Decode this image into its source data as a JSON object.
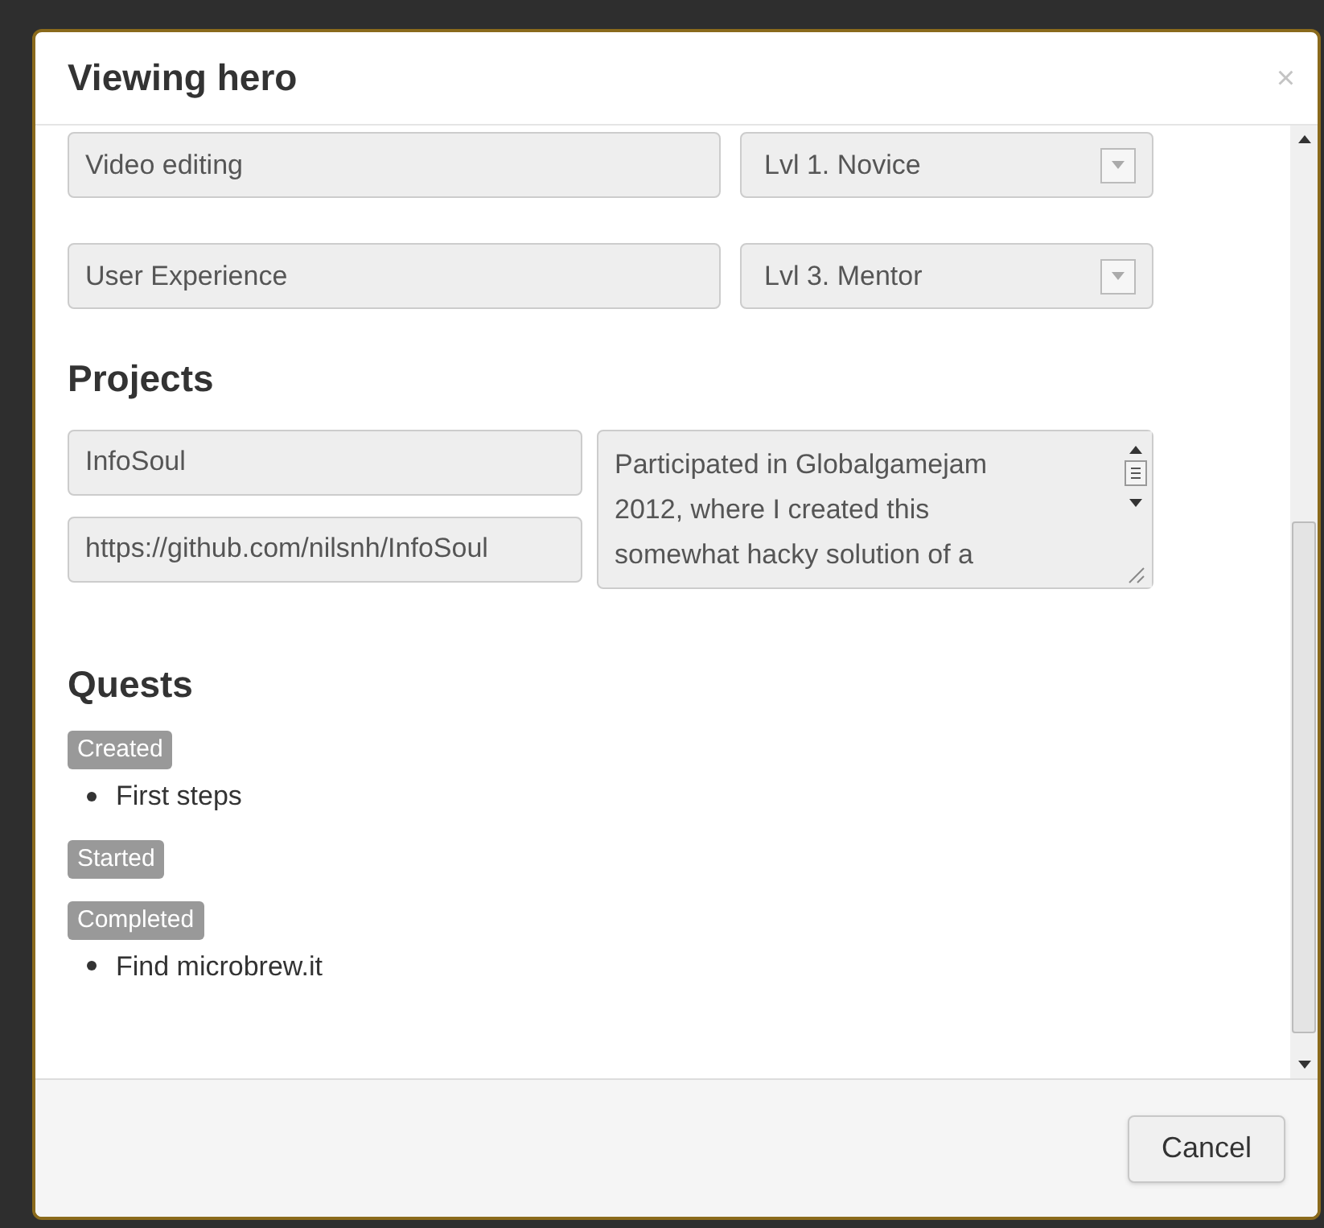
{
  "modal": {
    "title": "Viewing hero",
    "close": "×"
  },
  "skills": [
    {
      "name": "Video editing",
      "level": "Lvl 1. Novice"
    },
    {
      "name": "User Experience",
      "level": "Lvl 3. Mentor"
    }
  ],
  "projects_heading": "Projects",
  "projects": [
    {
      "name": "InfoSoul",
      "url": "https://github.com/nilsnh/InfoSoul",
      "description_lines": [
        "Participated in Globalgamejam",
        "2012, where I created this",
        "somewhat hacky solution of a"
      ]
    }
  ],
  "quests_heading": "Quests",
  "quest_groups": [
    {
      "label": "Created",
      "items": [
        "First steps"
      ]
    },
    {
      "label": "Started"
    },
    {
      "label": "Completed",
      "items": [
        "Find microbrew.it"
      ]
    }
  ],
  "footer": {
    "cancel": "Cancel"
  }
}
